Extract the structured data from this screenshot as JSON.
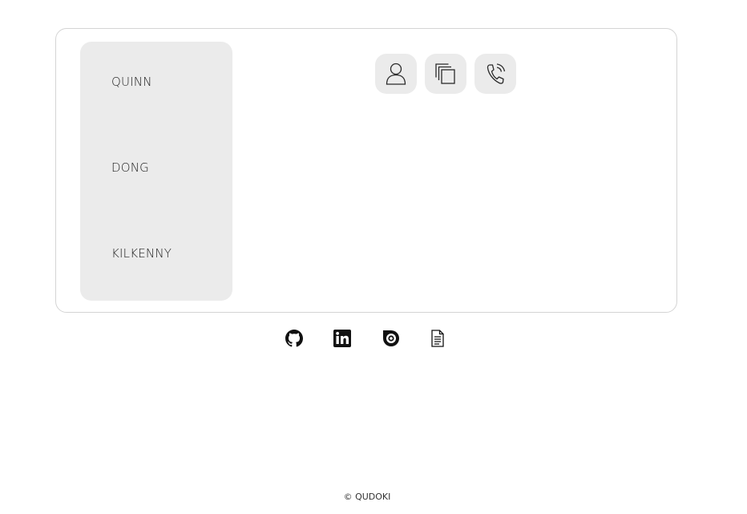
{
  "names": {
    "first": "QUINN",
    "middle": "DONG",
    "last": "KILKENNY"
  },
  "action_icons": [
    "person-icon",
    "copy-icon",
    "phone-icon"
  ],
  "social_icons": [
    "github-icon",
    "linkedin-icon",
    "issuu-icon",
    "document-icon"
  ],
  "footer": {
    "copyright": "© QUDOKI"
  },
  "colors": {
    "panel_bg": "#ebebeb",
    "card_border": "#d4d4d4",
    "text": "#1f1f1f"
  }
}
